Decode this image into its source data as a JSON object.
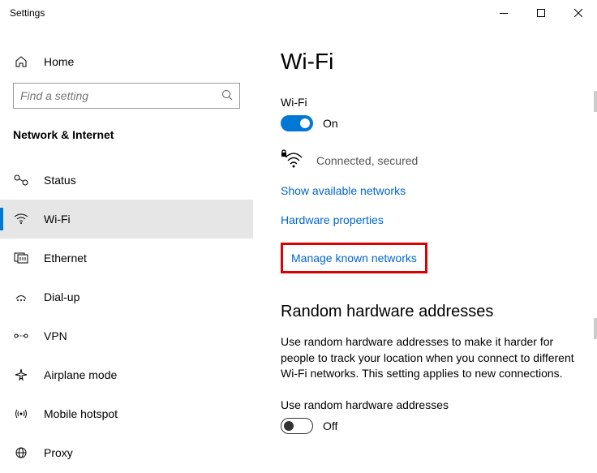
{
  "window": {
    "title": "Settings"
  },
  "sidebar": {
    "home": "Home",
    "search_placeholder": "Find a setting",
    "section": "Network & Internet",
    "items": [
      {
        "label": "Status"
      },
      {
        "label": "Wi-Fi"
      },
      {
        "label": "Ethernet"
      },
      {
        "label": "Dial-up"
      },
      {
        "label": "VPN"
      },
      {
        "label": "Airplane mode"
      },
      {
        "label": "Mobile hotspot"
      },
      {
        "label": "Proxy"
      }
    ]
  },
  "content": {
    "title": "Wi-Fi",
    "wifi_label": "Wi-Fi",
    "wifi_state": "On",
    "conn_status": "Connected, secured",
    "links": {
      "show_networks": "Show available networks",
      "hw_props": "Hardware properties",
      "manage_known": "Manage known networks"
    },
    "random_heading": "Random hardware addresses",
    "random_body": "Use random hardware addresses to make it harder for people to track your location when you connect to different Wi-Fi networks. This setting applies to new connections.",
    "random_toggle_label": "Use random hardware addresses",
    "random_state": "Off"
  }
}
